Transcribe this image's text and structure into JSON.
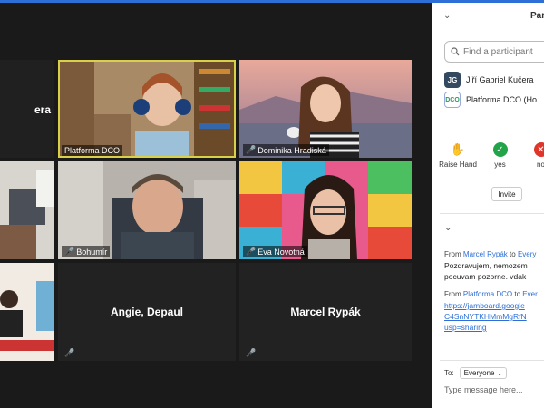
{
  "participants_tiles": [
    {
      "name": "Platforma DCO",
      "active": true
    },
    {
      "name": "Dominika Hradiská"
    },
    {
      "name": "Bohumír"
    },
    {
      "name": "Eva Novotná"
    },
    {
      "name": "Angie, Depaul"
    },
    {
      "name": "Marcel Rypák"
    },
    {
      "name": "era"
    }
  ],
  "panel": {
    "title": "Par",
    "search_placeholder": "Find a participant",
    "participants": [
      {
        "initials": "JG",
        "name": "Jiří Gabriel Kučera"
      },
      {
        "initials": "DCO",
        "name": "Platforma DCO (Ho"
      }
    ],
    "reactions": [
      {
        "label": "Raise Hand",
        "color": "#3a82e8"
      },
      {
        "label": "yes",
        "color": "#23a34a"
      },
      {
        "label": "no",
        "color": "#e0352b"
      }
    ],
    "invite_label": "Invite"
  },
  "chat": {
    "messages": [
      {
        "from_prefix": "From",
        "from": "Marcel Rypák",
        "to_prefix": "to",
        "to": "Every",
        "lines": [
          "Pozdravujem, nemozem",
          "pocuvam pozorne. vdak"
        ]
      },
      {
        "from_prefix": "From",
        "from": "Platforma DCO",
        "to_prefix": "to",
        "to": "Ever",
        "links": [
          "https://jamboard.google",
          "C4SnNYTKHMmMgRfN",
          "usp=sharing"
        ]
      }
    ],
    "to_label": "To:",
    "recipient": "Everyone",
    "compose_placeholder": "Type message here..."
  },
  "colors": {
    "accent": "#2d6fd6",
    "mute": "#e0352b",
    "active_border": "#d9d04a"
  }
}
